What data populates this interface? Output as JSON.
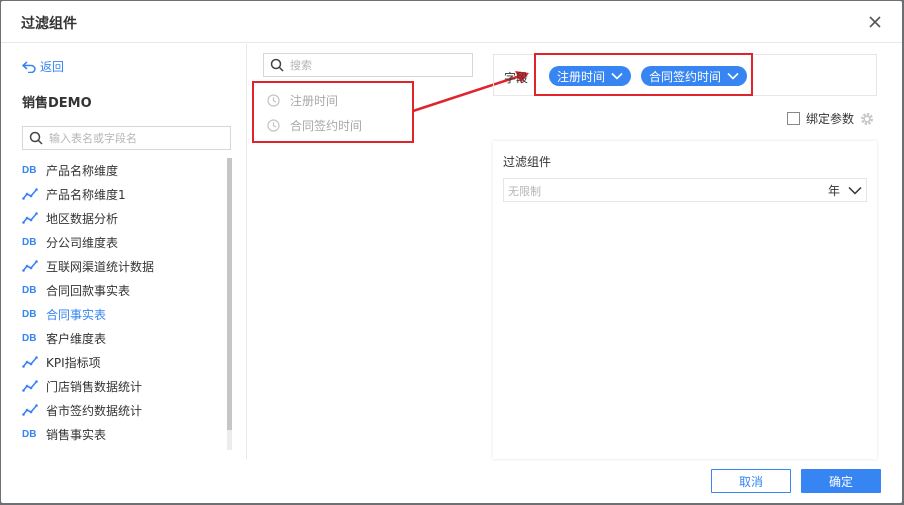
{
  "dialog": {
    "title": "过滤组件"
  },
  "left": {
    "back_label": "返回",
    "dataset_name": "销售DEMO",
    "search_placeholder": "输入表名或字段名",
    "tables": [
      {
        "label": "产品名称维度",
        "icon": "db-table-icon"
      },
      {
        "label": "产品名称维度1",
        "icon": "line-chart-icon"
      },
      {
        "label": "地区数据分析",
        "icon": "line-chart-icon"
      },
      {
        "label": "分公司维度表",
        "icon": "db-table-icon"
      },
      {
        "label": "互联网渠道统计数据",
        "icon": "line-chart-icon"
      },
      {
        "label": "合同回款事实表",
        "icon": "db-table-icon"
      },
      {
        "label": "合同事实表",
        "icon": "db-table-icon",
        "active": true
      },
      {
        "label": "客户维度表",
        "icon": "db-table-icon"
      },
      {
        "label": "KPI指标项",
        "icon": "line-chart-icon"
      },
      {
        "label": "门店销售数据统计",
        "icon": "line-chart-icon"
      },
      {
        "label": "省市签约数据统计",
        "icon": "line-chart-icon"
      },
      {
        "label": "销售事实表",
        "icon": "db-table-icon"
      }
    ],
    "db_icon_text": "DB"
  },
  "middle": {
    "search_placeholder": "搜索",
    "fields": [
      {
        "label": "注册时间",
        "icon": "clock-icon"
      },
      {
        "label": "合同签约时间",
        "icon": "clock-icon"
      }
    ]
  },
  "right": {
    "field_slot_label": "字段",
    "chips": [
      "注册时间",
      "合同签约时间"
    ],
    "bind_param_label": "绑定参数",
    "preview_title": "过滤组件",
    "preview_placeholder": "无限制",
    "preview_unit": "年"
  },
  "footer": {
    "cancel_label": "取消",
    "ok_label": "确定"
  },
  "colors": {
    "accent": "#3685f2",
    "highlight": "#e0242c"
  }
}
